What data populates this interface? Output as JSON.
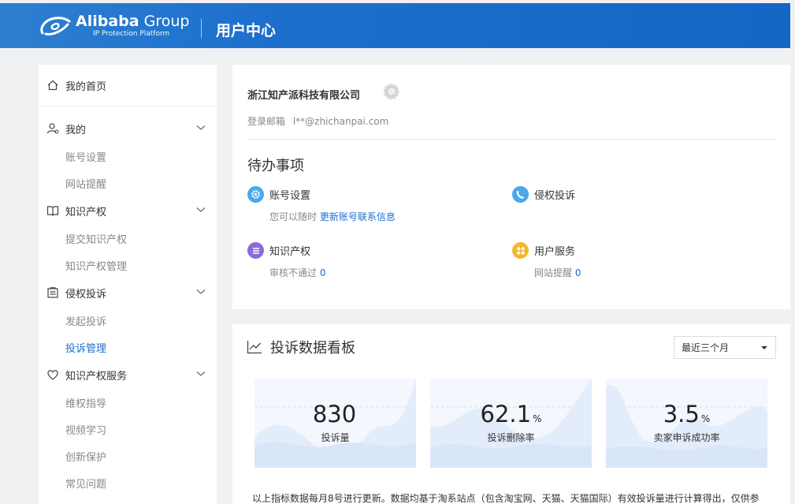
{
  "header": {
    "brand_name": "Alibaba",
    "brand_suffix": "Group",
    "brand_tagline": "IP Protection Platform",
    "title": "用户中心",
    "colors": {
      "bar": "#1c6fcc"
    }
  },
  "sidebar": {
    "home": {
      "label": "我的首页",
      "icon": "home-icon"
    },
    "groups": [
      {
        "label": "我的",
        "icon": "user-icon",
        "items": [
          "账号设置",
          "网站提醒"
        ]
      },
      {
        "label": "知识产权",
        "icon": "book-icon",
        "items": [
          "提交知识产权",
          "知识产权管理"
        ]
      },
      {
        "label": "侵权投诉",
        "icon": "clipboard-icon",
        "items": [
          "发起投诉",
          "投诉管理"
        ]
      },
      {
        "label": "知识产权服务",
        "icon": "heart-icon",
        "items": [
          "维权指导",
          "视频学习",
          "创新保护",
          "常见问题"
        ]
      }
    ],
    "active_item": "投诉管理"
  },
  "profile": {
    "company": "浙江知产派科技有限公司",
    "email_label": "登录邮箱",
    "email": "l**@zhichanpai.com",
    "todo_title": "待办事项",
    "todos": [
      {
        "title": "账号设置",
        "icon": "gear-icon",
        "color": "#4aa8ec",
        "sub_text": "您可以随时",
        "sub_link": "更新账号联系信息"
      },
      {
        "title": "侵权投诉",
        "icon": "phone-icon",
        "color": "#4aa8ec",
        "sub_text": "",
        "sub_link": ""
      },
      {
        "title": "知识产权",
        "icon": "list-icon",
        "color": "#8e6ad8",
        "sub_text": "审核不通过",
        "sub_link": "0"
      },
      {
        "title": "用户服务",
        "icon": "grid-icon",
        "color": "#f2b82c",
        "sub_text": "网站提醒",
        "sub_link": "0"
      }
    ]
  },
  "dashboard": {
    "title": "投诉数据看板",
    "period": "最近三个月",
    "stats": [
      {
        "value": "830",
        "unit": "",
        "label": "投诉量"
      },
      {
        "value": "62.1",
        "unit": "%",
        "label": "投诉删除率"
      },
      {
        "value": "3.5",
        "unit": "%",
        "label": "卖家申诉成功率"
      }
    ],
    "note": "以上指标数据每月8号进行更新。数据均基于淘系站点（包含淘宝网、天猫、天猫国际）有效投诉量进行计算得出，仅供参"
  }
}
